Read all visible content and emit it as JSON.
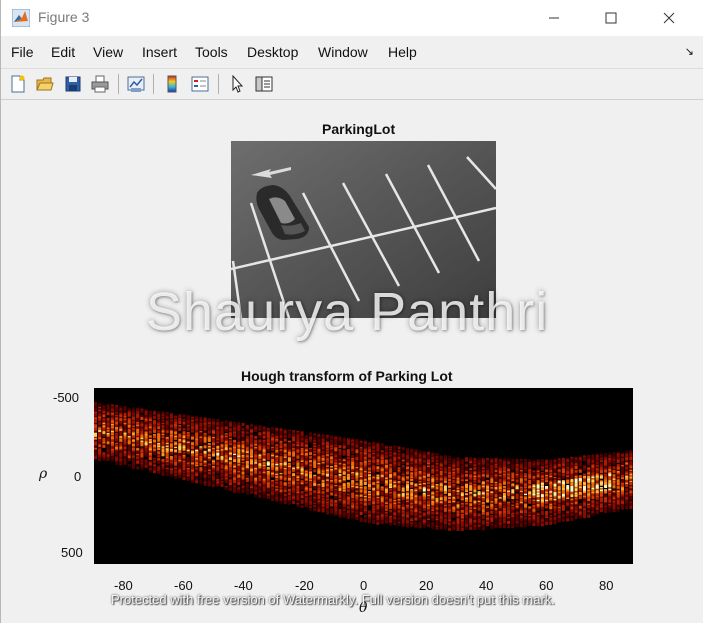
{
  "window": {
    "title": "Figure 3",
    "controls": [
      "minimize-icon",
      "maximize-icon",
      "close-icon"
    ]
  },
  "menu": [
    "File",
    "Edit",
    "View",
    "Insert",
    "Tools",
    "Desktop",
    "Window",
    "Help"
  ],
  "toolbar": {
    "icons": [
      "new-figure-icon",
      "open-file-icon",
      "save-icon",
      "print-icon",
      "link-plot-icon",
      "colorbar-icon",
      "legend-icon",
      "pointer-icon",
      "property-editor-icon"
    ]
  },
  "image_axes": {
    "title": "ParkingLot"
  },
  "chart_data": {
    "type": "heatmap",
    "title": "Hough transform of Parking Lot",
    "xlabel": "θ",
    "ylabel": "ρ",
    "x_range": [
      -90,
      89
    ],
    "y_range": [
      -570,
      570
    ],
    "y_reversed": true,
    "x_ticks": [
      "-80",
      "-60",
      "-40",
      "-20",
      "0",
      "20",
      "40",
      "60",
      "80"
    ],
    "y_ticks": [
      "-500",
      "0",
      "500"
    ],
    "colormap": "hot",
    "band_center_curve": [
      {
        "theta": -90,
        "rho": -300
      },
      {
        "theta": -60,
        "rho": -190
      },
      {
        "theta": -30,
        "rho": -80
      },
      {
        "theta": 0,
        "rho": 30
      },
      {
        "theta": 30,
        "rho": 110
      },
      {
        "theta": 60,
        "rho": 100
      },
      {
        "theta": 89,
        "rho": 10
      }
    ]
  },
  "watermark": {
    "text": "Shaurya Panthri",
    "footer": "Protected with free version of Watermarkly. Full version doesn't put this mark."
  }
}
